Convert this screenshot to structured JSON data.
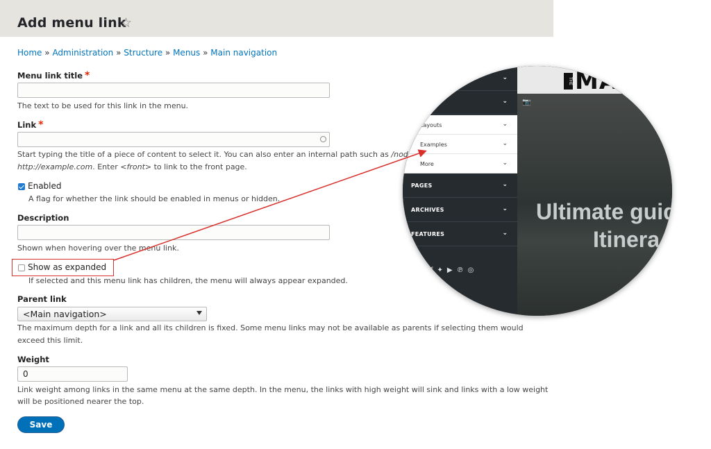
{
  "header": {
    "title": "Add menu link",
    "star_icon": "☆"
  },
  "breadcrumb": {
    "items": [
      "Home",
      "Administration",
      "Structure",
      "Menus",
      "Main navigation"
    ],
    "separator": "»"
  },
  "form": {
    "title_field": {
      "label": "Menu link title",
      "required_mark": "*",
      "value": "",
      "description": "The text to be used for this link in the menu."
    },
    "link_field": {
      "label": "Link",
      "required_mark": "*",
      "value": "",
      "description_line1_a": "Start typing the title of a piece of content to select it. You can also enter an internal path such as ",
      "description_line1_em": "/node/a",
      "description_line2_em1": "http://example.com",
      "description_line2_a": ". Enter ",
      "description_line2_em2": "<front>",
      "description_line2_b": " to link to the front page."
    },
    "enabled": {
      "label": "Enabled",
      "checked": true,
      "description": "A flag for whether the link should be enabled in menus or hidden."
    },
    "description_field": {
      "label": "Description",
      "value": "",
      "description": "Shown when hovering over the menu link."
    },
    "expanded": {
      "label": "Show as expanded",
      "checked": false,
      "description": "If selected and this menu link has children, the menu will always appear expanded."
    },
    "parent": {
      "label": "Parent link",
      "selected": "<Main navigation>",
      "description_line1": "The maximum depth for a link and all its children is fixed. Some menu links may not be available as parents if selecting them would",
      "description_line2": "exceed this limit."
    },
    "weight": {
      "label": "Weight",
      "value": "0",
      "description_line1": "Link weight among links in the same menu at the same depth. In the menu, the links with high weight will sink and links with a low weight",
      "description_line2": "will be positioned nearer the top."
    },
    "save_label": "Save"
  },
  "magnifier": {
    "logo_small": "THE",
    "logo": "MA",
    "menu_rows_top": [
      "",
      ""
    ],
    "submenu": [
      "Layouts",
      "Examples",
      "More"
    ],
    "menu_rows": [
      "PAGES",
      "ARCHIVES",
      "FEATURES"
    ],
    "hero_line1": "Ultimate guid",
    "hero_line2": "Itinera"
  },
  "colors": {
    "link": "#0074bd",
    "accent": "#0071b8",
    "highlight": "#d9302c"
  }
}
